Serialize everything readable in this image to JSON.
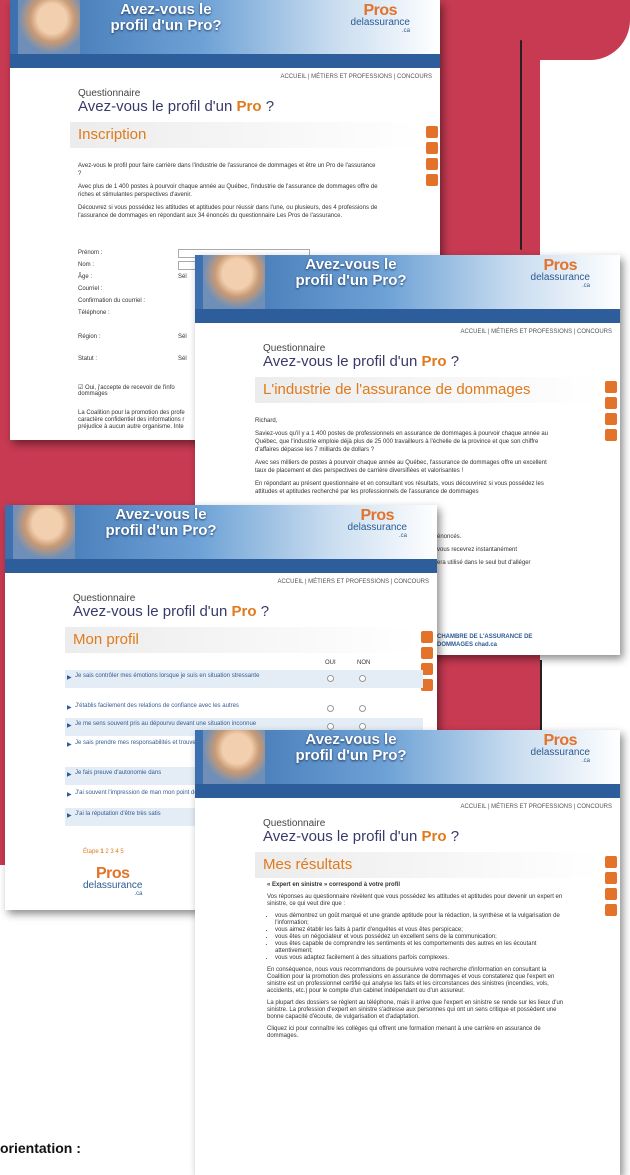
{
  "header": {
    "title_l1": "Avez-vous le",
    "title_l2": "profil d'un Pro?",
    "logo_main": "Pros",
    "logo_sub": "delassurance",
    "logo_ext": ".ca"
  },
  "nav": {
    "accueil": "ACCUEIL",
    "metiers": "MÉTIERS ET PROFESSIONS",
    "concours": "CONCOURS",
    "sep": "|"
  },
  "q": {
    "sub": "Questionnaire",
    "title_pre": "Avez-vous le profil d'un",
    "title_pro": "Pro",
    "title_post": "?"
  },
  "shot1": {
    "section": "Inscription",
    "p1": "Avez-vous le profil pour faire carrière dans l'industrie de l'assurance de dommages et être un Pro de l'assurance ?",
    "p2": "Avec plus de 1 400 postes à pourvoir chaque année au Québec, l'industrie de l'assurance de dommages offre de riches et stimulantes perspectives d'avenir.",
    "p3": "Découvrez si vous possédez les attitudes et aptitudes pour réussir dans l'une, ou plusieurs, des 4 professions de l'assurance de dommages en répondant aux 34 énoncés du questionnaire Les Pros de l'assurance.",
    "fields": [
      "Prénom :",
      "Nom :",
      "Âge :",
      "Courriel :",
      "Confirmation du courriel :",
      "Téléphone :",
      "Région :",
      "Statut :"
    ],
    "sel": "Sél",
    "consent": "Oui, j'accepte de recevoir de l'info",
    "consent2": "dommages",
    "foot1": "La Coalition pour la promotion des profe",
    "foot2": "caractère confidentiel des informations r",
    "foot3": "préjudice à aucun autre organisme. Inte"
  },
  "shot2": {
    "section": "L'industrie de l'assurance de dommages",
    "greet": "Richard,",
    "p1": "Saviez-vous qu'il y a 1 400 postes de professionnels en assurance de dommages à pourvoir chaque année au Québec, que l'industrie emploie déjà plus de 25 000 travailleurs à l'échelle de la province et que son chiffre d'affaires dépasse les 7 milliards de dollars ?",
    "p2": "Avec ses milliers de postes à pourvoir chaque année au Québec, l'assurance de dommages offre un excellent taux de placement et des perspectives de carrière diversifiées et valorisantes !",
    "p3": "En répondant au présent questionnaire et en consultant vos résultats, vous découvrirez si vous possédez les attitudes et aptitudes recherché par les professionnels de l'assurance de dommages",
    "p4": "énoncés.",
    "p5": "vous recevrez instantanément",
    "p6": "era utilisé dans le seul but d'alléger",
    "chad": "CHAMBRE DE L'ASSURANCE DE DOMMAGES",
    "chad2": "chad.ca"
  },
  "shot3": {
    "section": "Mon profil",
    "oui": "OUI",
    "non": "NON",
    "rows": [
      "Je sais contrôler mes émotions lorsque je suis en situation stressante",
      "J'établis facilement des relations de confiance avec les autres",
      "Je me sens souvent pris au dépourvu devant une situation inconnue",
      "Je sais prendre mes responsabilités et trouver des solutions à mes problèmes",
      "Je fais preuve d'autonomie dans",
      "J'ai souvent l'impression de man mon point de vue",
      "J'ai la réputation d'être très satis"
    ],
    "etape": "Étape",
    "steps": [
      "1",
      "2",
      "3",
      "4",
      "5"
    ]
  },
  "shot4": {
    "section": "Mes résultats",
    "headline": "« Expert en sinistre » correspond à votre profil",
    "p1": "Vos réponses au questionnaire révèlent que vous possédez les attitudes et aptitudes pour devenir un expert en sinistre, ce qui veut dire que :",
    "bullets": [
      "vous démontrez un goût marqué et une grande aptitude pour la rédaction, la synthèse et la vulgarisation de l'information;",
      "vous aimez établir les faits à partir d'enquêtes et vous êtes perspicace;",
      "vous êtes un négociateur et vous possédez un excellent sens de la communication;",
      "vous êtes capable de comprendre les sentiments et les comportements des autres en les écoutant attentivement;",
      "vous vous adaptez facilement à des situations parfois complexes."
    ],
    "p2": "En conséquence, nous vous recommandons de poursuivre votre recherche d'information en consultant la Coalition pour la promotion des professions en assurance de dommages et vous constaterez que l'expert en sinistre est un professionnel certifié qui analyse les faits et les circonstances des sinistres (incendies, vols, accidents, etc.) pour le compte d'un cabinet indépendant ou d'un assureur.",
    "p3": "La plupart des dossiers se règlent au téléphone, mais il arrive que l'expert en sinistre se rende sur les lieux d'un sinistre. La profession d'expert en sinistre s'adresse aux personnes qui ont un sens critique et possèdent une bonne capacité d'écoute, de vulgarisation et d'adaptation.",
    "p4": "Cliquez ici pour connaître les collèges qui offrent une formation menant à une carrière en assurance de dommages."
  },
  "caption": "orientation :",
  "colors": {
    "bg": "#c73a52",
    "accent": "#e07a1a",
    "blue": "#2d5d9a"
  }
}
